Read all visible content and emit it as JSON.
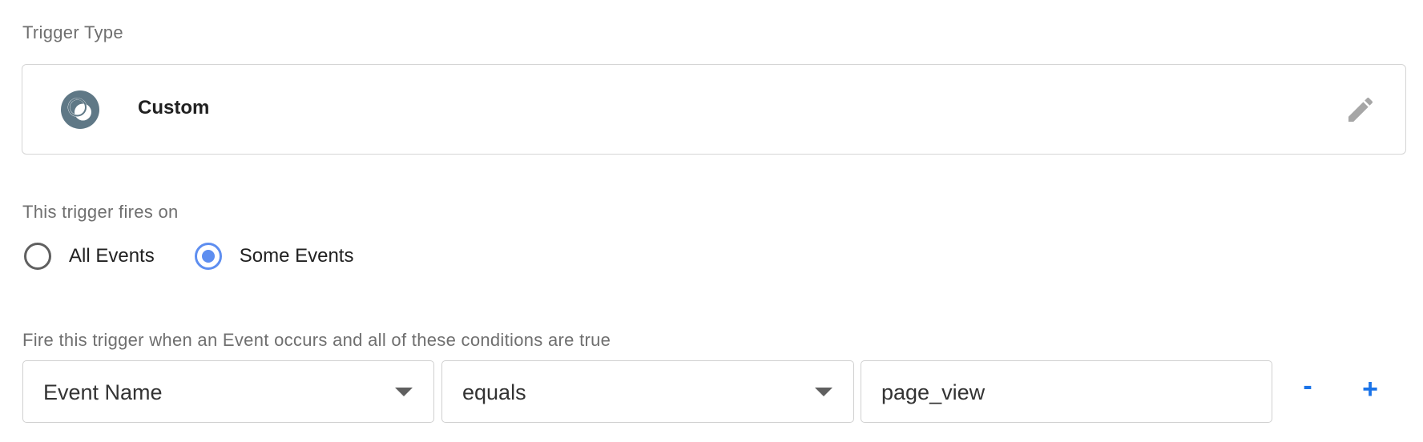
{
  "trigger_type": {
    "section_label": "Trigger Type",
    "name": "Custom",
    "icon": "custom-event-icon",
    "edit_icon": "pencil-icon"
  },
  "fires_on": {
    "section_label": "This trigger fires on",
    "options": [
      {
        "label": "All Events",
        "selected": false
      },
      {
        "label": "Some Events",
        "selected": true
      }
    ]
  },
  "conditions": {
    "section_label": "Fire this trigger when an Event occurs and all of these conditions are true",
    "rows": [
      {
        "variable": "Event Name",
        "operator": "equals",
        "value": "page_view"
      }
    ],
    "remove_label": "-",
    "add_label": "+"
  },
  "colors": {
    "accent": "#1a73e8",
    "radio_selected": "#5e8ef0",
    "icon_background": "#5f7886",
    "label_gray": "#6f6f6f"
  }
}
